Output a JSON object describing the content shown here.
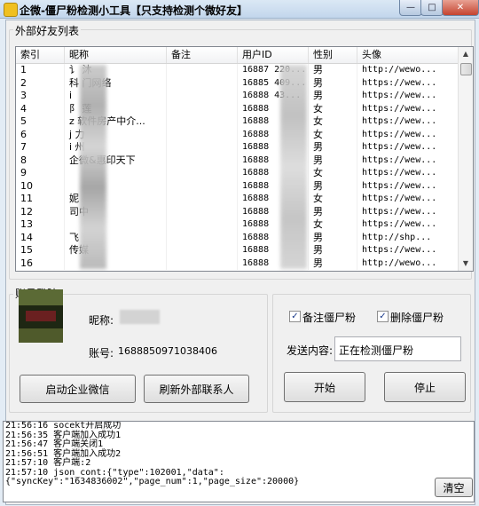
{
  "window": {
    "title": "企微-僵尸粉检测小工具【只支持检测个微好友】"
  },
  "friends": {
    "group_title": "外部好友列表",
    "columns": [
      "索引",
      "昵称",
      "备注",
      "用户ID",
      "性别",
      "头像"
    ],
    "rows": [
      {
        "index": "1",
        "nickname": "讠 沐",
        "remark": "",
        "user_id": "16887  220...",
        "gender": "男",
        "avatar": "http://wewo..."
      },
      {
        "index": "2",
        "nickname": "科 门网络",
        "remark": "",
        "user_id": "16885  409...",
        "gender": "男",
        "avatar": "https://wew..."
      },
      {
        "index": "3",
        "nickname": "i",
        "remark": "",
        "user_id": "16888  43...",
        "gender": "男",
        "avatar": "https://wew..."
      },
      {
        "index": "4",
        "nickname": "阝 莲",
        "remark": "",
        "user_id": "16888",
        "gender": "女",
        "avatar": "https://wew..."
      },
      {
        "index": "5",
        "nickname": "z 软件房产中介...",
        "remark": "",
        "user_id": "16888",
        "gender": "女",
        "avatar": "https://wew..."
      },
      {
        "index": "6",
        "nickname": "j 力",
        "remark": "",
        "user_id": "16888",
        "gender": "女",
        "avatar": "https://wew..."
      },
      {
        "index": "7",
        "nickname": "i 州",
        "remark": "",
        "user_id": "16888",
        "gender": "男",
        "avatar": "https://wew..."
      },
      {
        "index": "8",
        "nickname": "  企微&惠印天下",
        "remark": "",
        "user_id": "16888",
        "gender": "男",
        "avatar": "https://wew..."
      },
      {
        "index": "9",
        "nickname": "",
        "remark": "",
        "user_id": "16888",
        "gender": "女",
        "avatar": "https://wew..."
      },
      {
        "index": "10",
        "nickname": "",
        "remark": "",
        "user_id": "16888",
        "gender": "男",
        "avatar": "https://wew..."
      },
      {
        "index": "11",
        "nickname": "  妮",
        "remark": "",
        "user_id": "16888",
        "gender": "女",
        "avatar": "https://wew..."
      },
      {
        "index": "12",
        "nickname": "  司中",
        "remark": "",
        "user_id": "16888",
        "gender": "男",
        "avatar": "https://wew..."
      },
      {
        "index": "13",
        "nickname": "",
        "remark": "",
        "user_id": "16888",
        "gender": "女",
        "avatar": "https://wew..."
      },
      {
        "index": "14",
        "nickname": "  飞",
        "remark": "",
        "user_id": "16888",
        "gender": "男",
        "avatar": "http://shp..."
      },
      {
        "index": "15",
        "nickname": "  传媒",
        "remark": "",
        "user_id": "16888",
        "gender": "男",
        "avatar": "https://wew..."
      },
      {
        "index": "16",
        "nickname": "",
        "remark": "",
        "user_id": "16888",
        "gender": "男",
        "avatar": "http://wewo..."
      }
    ]
  },
  "login": {
    "group_title": "账号登陆",
    "nickname_label": "昵称:",
    "account_label": "账号:",
    "account_value": "1688850971038406",
    "start_button": "启动企业微信",
    "refresh_button": "刷新外部联系人"
  },
  "options": {
    "remark_zombie": "备注僵尸粉",
    "delete_zombie": "删除僵尸粉",
    "send_label": "发送内容:",
    "send_value": "正在检测僵尸粉",
    "start_button": "开始",
    "stop_button": "停止"
  },
  "log": {
    "lines": [
      "21:56:16 socekt开启成功",
      "21:56:35 客户端加入成功1",
      "21:56:47 客户端关闭1",
      "21:56:51 客户端加入成功2",
      "21:57:10 客户端:2",
      "21:57:10 json_cont:{\"type\":102001,\"data\":",
      "{\"syncKey\":\"1634836002\",\"page_num\":1,\"page_size\":20000}"
    ],
    "clear_button": "清空"
  }
}
